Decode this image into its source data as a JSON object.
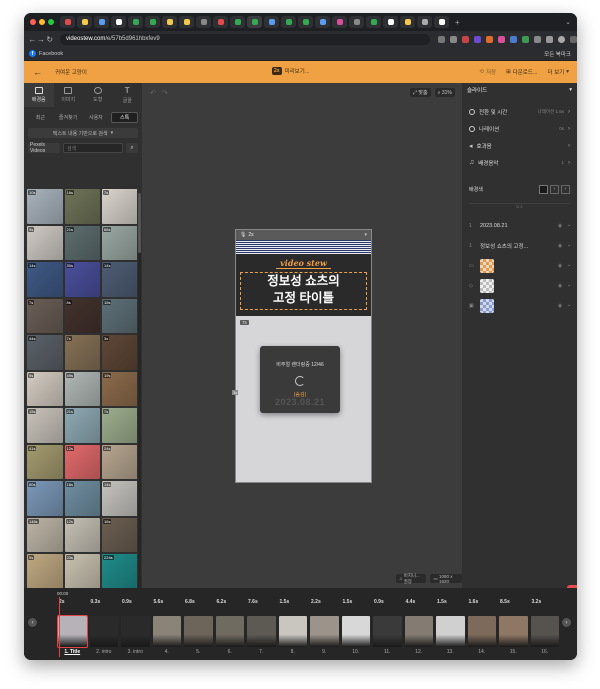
{
  "browser": {
    "url_host": "videostew.com",
    "url_path": "/e/57b5d961hbxfev9",
    "bookmark": "Facebook",
    "all_bookmarks": "모든 북마크"
  },
  "header": {
    "project_name": "귀여운 고양이",
    "preview_chip": "2x",
    "preview_label": "미리보기...",
    "save_label": "저장",
    "download_label": "다운로드...",
    "more_label": "더 보기"
  },
  "left": {
    "tabs": [
      "배경음",
      "이미지",
      "도형",
      "글꼴"
    ],
    "subtabs": [
      "최근",
      "즐겨찾기",
      "사용자",
      "스톡"
    ],
    "active_subtab": 3,
    "search_by_text": "텍스트 내용 기반으로 검색",
    "source": "Pexels Videos",
    "search_placeholder": "검색",
    "powered_by": "Powered by Pexels.com",
    "thumbs": [
      {
        "d": "10s",
        "c": "#a9b3bd"
      },
      {
        "d": "16s",
        "c": "#6e7358"
      },
      {
        "d": "7s",
        "c": "#d9d4cc"
      },
      {
        "d": "9s",
        "c": "#cfcac4"
      },
      {
        "d": "21s",
        "c": "#5d6d6e"
      },
      {
        "d": "66s",
        "c": "#9aa8a3"
      },
      {
        "d": "14s",
        "c": "#3f5a86"
      },
      {
        "d": "30s",
        "c": "#4a4f9c"
      },
      {
        "d": "14s",
        "c": "#4e5d74"
      },
      {
        "d": "7s",
        "c": "#6a5e56"
      },
      {
        "d": "8s",
        "c": "#43322d"
      },
      {
        "d": "15s",
        "c": "#5d7077"
      },
      {
        "d": "44s",
        "c": "#5a6168"
      },
      {
        "d": "7s",
        "c": "#857156"
      },
      {
        "d": "3s",
        "c": "#5e4737"
      },
      {
        "d": "9s",
        "c": "#d4ccc2"
      },
      {
        "d": "49s",
        "c": "#b0b8b5"
      },
      {
        "d": "19s",
        "c": "#8c6b4c"
      },
      {
        "d": "15s",
        "c": "#c9c3bb"
      },
      {
        "d": "21s",
        "c": "#8faab5"
      },
      {
        "d": "7s",
        "c": "#9dae8e"
      },
      {
        "d": "41s",
        "c": "#a49b6e"
      },
      {
        "d": "12s",
        "c": "#e26a6b"
      },
      {
        "d": "24s",
        "c": "#b7a691"
      },
      {
        "d": "60s",
        "c": "#7b98b8"
      },
      {
        "d": "16s",
        "c": "#6f8ea1"
      },
      {
        "d": "14s",
        "c": "#c5c4bf"
      },
      {
        "d": "146s",
        "c": "#bdb5a7"
      },
      {
        "d": "12s",
        "c": "#c6c0b5"
      },
      {
        "d": "16s",
        "c": "#6b5e51"
      },
      {
        "d": "9s",
        "c": "#c0a982"
      },
      {
        "d": "23s",
        "c": "#c9c2b1"
      },
      {
        "d": "224s",
        "c": "#1f8c8a"
      }
    ]
  },
  "canvas": {
    "fit_label": "맞춤",
    "zoom": "31%",
    "scene_chip": "2s",
    "brand": "video stew",
    "title_line1": "정보성 쇼츠의",
    "title_line2": "고정 타이틀",
    "layer_chip": "7s",
    "side_chip": "1s",
    "render_status": "비주얼 렌더링중 12/46",
    "hidden_tag": "(숨김)",
    "date_text": "2023.08.21",
    "footer_quality": "비지니...권장",
    "footer_resolution": "1080 x 1920"
  },
  "right": {
    "panel_title": "슬라이드",
    "rows": [
      {
        "label": "전환 및 시간",
        "value": "나레이션 1.5s"
      },
      {
        "label": "나레이션",
        "value": "0s"
      },
      {
        "label": "효과음",
        "value": ""
      },
      {
        "label": "배경음악",
        "value": "1"
      }
    ],
    "bg_label": "배경색",
    "divider_label": "요소",
    "layers": [
      {
        "num": "1",
        "label": "2023.08.21"
      },
      {
        "num": "1",
        "label": "정보성 쇼츠의 고정..."
      }
    ],
    "feedback": "문의"
  },
  "timeline": {
    "timecode": "00:00",
    "clips": [
      {
        "d": "2s",
        "n": "1. Title",
        "c": "#b6b2b8",
        "sel": true
      },
      {
        "d": "0.3s",
        "n": "2. intro",
        "c": "#2a2a2a"
      },
      {
        "d": "0.9s",
        "n": "3. intro",
        "c": "#2a2a2a"
      },
      {
        "d": "5.6s",
        "n": "4.",
        "c": "#8a8378"
      },
      {
        "d": "6.8s",
        "n": "5.",
        "c": "#6d645a"
      },
      {
        "d": "6.2s",
        "n": "6.",
        "c": "#706b60"
      },
      {
        "d": "7.6s",
        "n": "7.",
        "c": "#5d5a54"
      },
      {
        "d": "1.5s",
        "n": "8.",
        "c": "#c9c6c0"
      },
      {
        "d": "2.2s",
        "n": "9.",
        "c": "#9c948b"
      },
      {
        "d": "1.5s",
        "n": "10.",
        "c": "#d8d8d8"
      },
      {
        "d": "0.9s",
        "n": "11.",
        "c": "#3a3a3a"
      },
      {
        "d": "4.4s",
        "n": "12.",
        "c": "#847c72"
      },
      {
        "d": "1.5s",
        "n": "13.",
        "c": "#d0d0d0"
      },
      {
        "d": "1.6s",
        "n": "14.",
        "c": "#7e6a5a"
      },
      {
        "d": "8.5s",
        "n": "15.",
        "c": "#8f7766"
      },
      {
        "d": "3.2s",
        "n": "16.",
        "c": "#56524e"
      }
    ]
  },
  "colors": {
    "accent": "#efa144",
    "panel": "#303030",
    "canvas": "#3c3c3c"
  }
}
